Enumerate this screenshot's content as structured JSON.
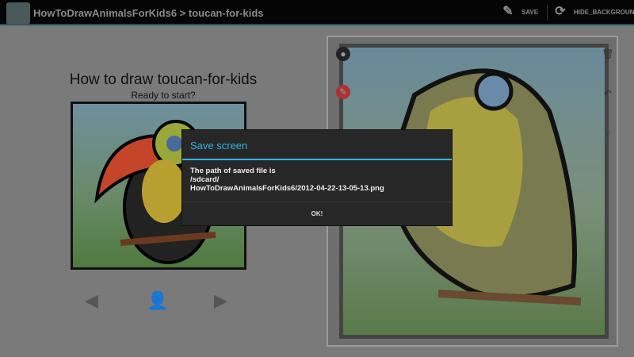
{
  "app_bar": {
    "breadcrumb": "HowToDrawAnimalsForKids6 > toucan-for-kids",
    "save_label": "SAVE",
    "hide_bg_label": "HIDE_BACKGROUND"
  },
  "left": {
    "title": "How to draw toucan-for-kids",
    "subtitle": "Ready to start?"
  },
  "dialog": {
    "title": "Save screen",
    "line1": "The path of saved file is",
    "line2": "/sdcard/",
    "line3": "HowToDrawAnimalsForKids6/2012-04-22-13-05-13.png",
    "ok_label": "OK!"
  },
  "colors": {
    "accent": "#33b5e5"
  }
}
